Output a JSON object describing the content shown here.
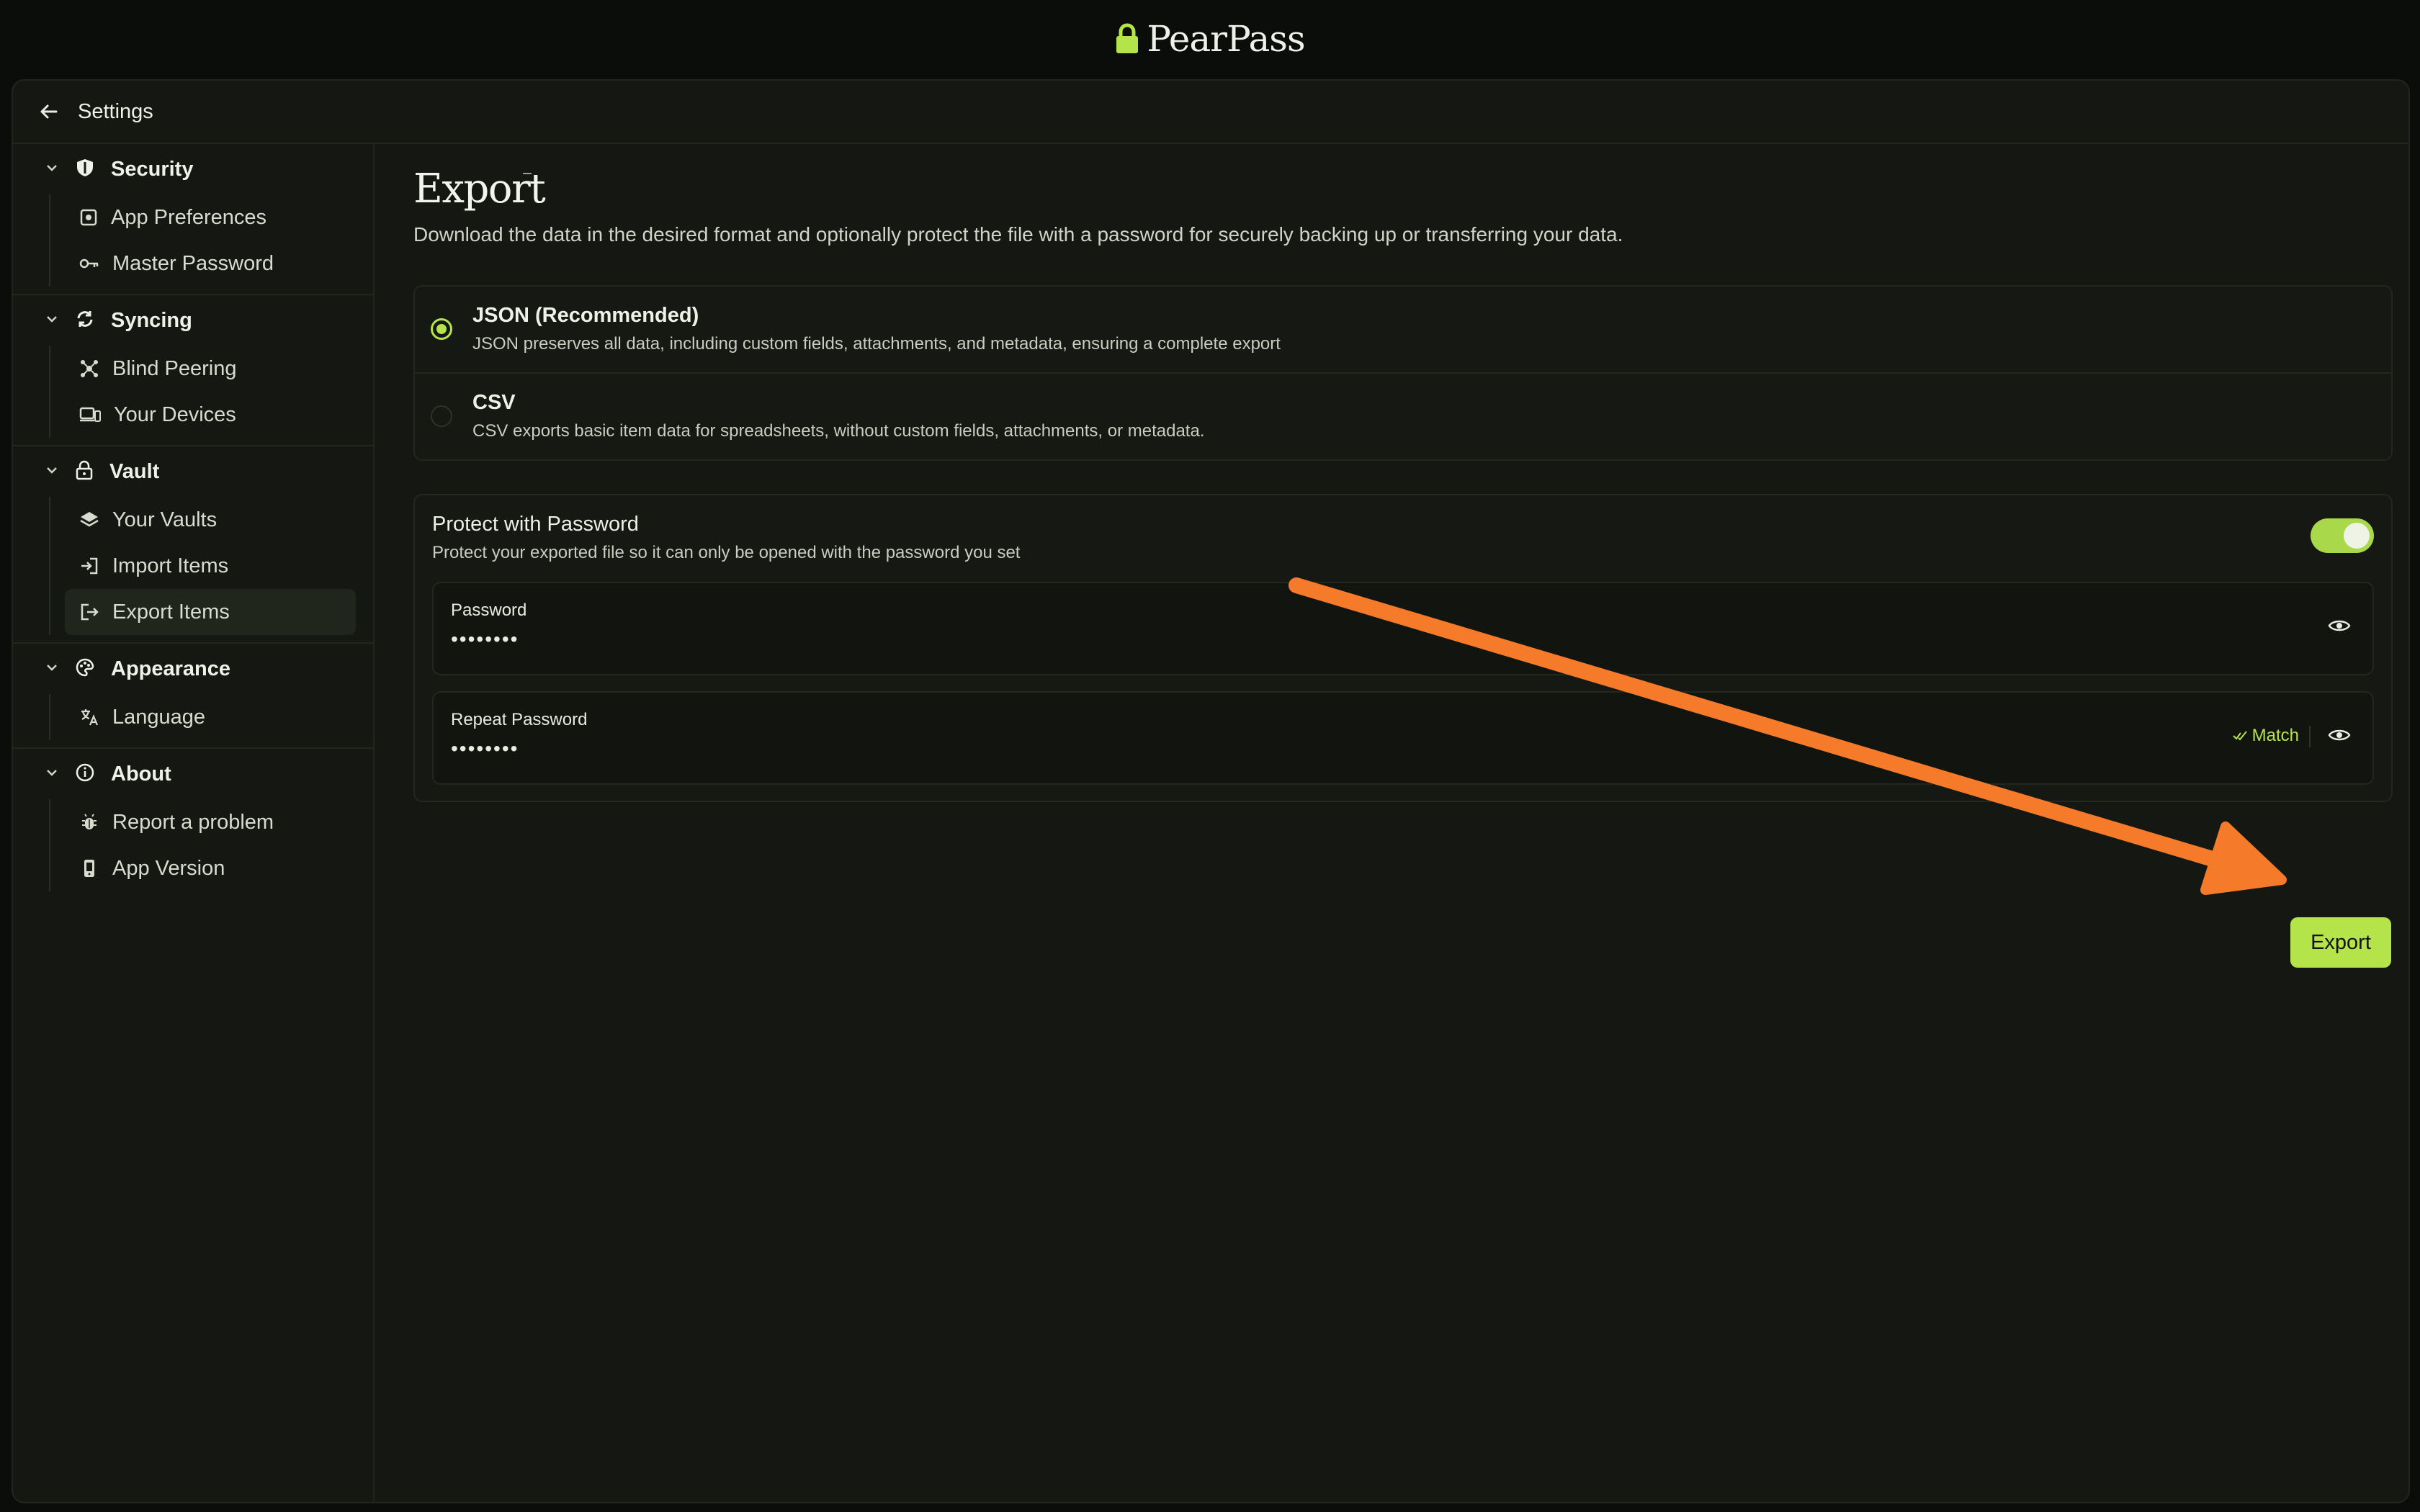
{
  "app": {
    "name": "PearPass"
  },
  "window": {
    "title": "Settings"
  },
  "sidebar": {
    "sections": [
      {
        "label": "Security",
        "items": [
          {
            "label": "App Preferences"
          },
          {
            "label": "Master Password"
          }
        ]
      },
      {
        "label": "Syncing",
        "items": [
          {
            "label": "Blind Peering"
          },
          {
            "label": "Your Devices"
          }
        ]
      },
      {
        "label": "Vault",
        "items": [
          {
            "label": "Your Vaults"
          },
          {
            "label": "Import Items"
          },
          {
            "label": "Export Items"
          }
        ]
      },
      {
        "label": "Appearance",
        "items": [
          {
            "label": "Language"
          }
        ]
      },
      {
        "label": "About",
        "items": [
          {
            "label": "Report a problem"
          },
          {
            "label": "App Version"
          }
        ]
      }
    ],
    "active_item": "Export Items"
  },
  "main": {
    "title": "Export",
    "description": "Download the data in the desired format and optionally protect the file with a password for securely backing up or transferring your data.",
    "formats": [
      {
        "name": "JSON (Recommended)",
        "description": "JSON preserves all data, including custom fields, attachments, and metadata, ensuring a complete export",
        "selected": true
      },
      {
        "name": "CSV",
        "description": "CSV exports basic item data for spreadsheets, without custom fields, attachments, or metadata.",
        "selected": false
      }
    ],
    "protect": {
      "title": "Protect with Password",
      "description": "Protect your exported file so it can only be opened with the password you set",
      "enabled": true,
      "password": {
        "label": "Password",
        "value": "••••••••"
      },
      "repeat_password": {
        "label": "Repeat Password",
        "value": "••••••••",
        "match_label": "Match"
      }
    },
    "export_button": "Export"
  },
  "colors": {
    "accent": "#b5e34a",
    "background": "#141712",
    "annotation_arrow": "#f57a2a"
  },
  "icons": {
    "brand": "lock-icon",
    "back": "arrow-left-icon",
    "chevron": "chevron-down-icon",
    "eye": "eye-icon",
    "check": "check-icon"
  }
}
